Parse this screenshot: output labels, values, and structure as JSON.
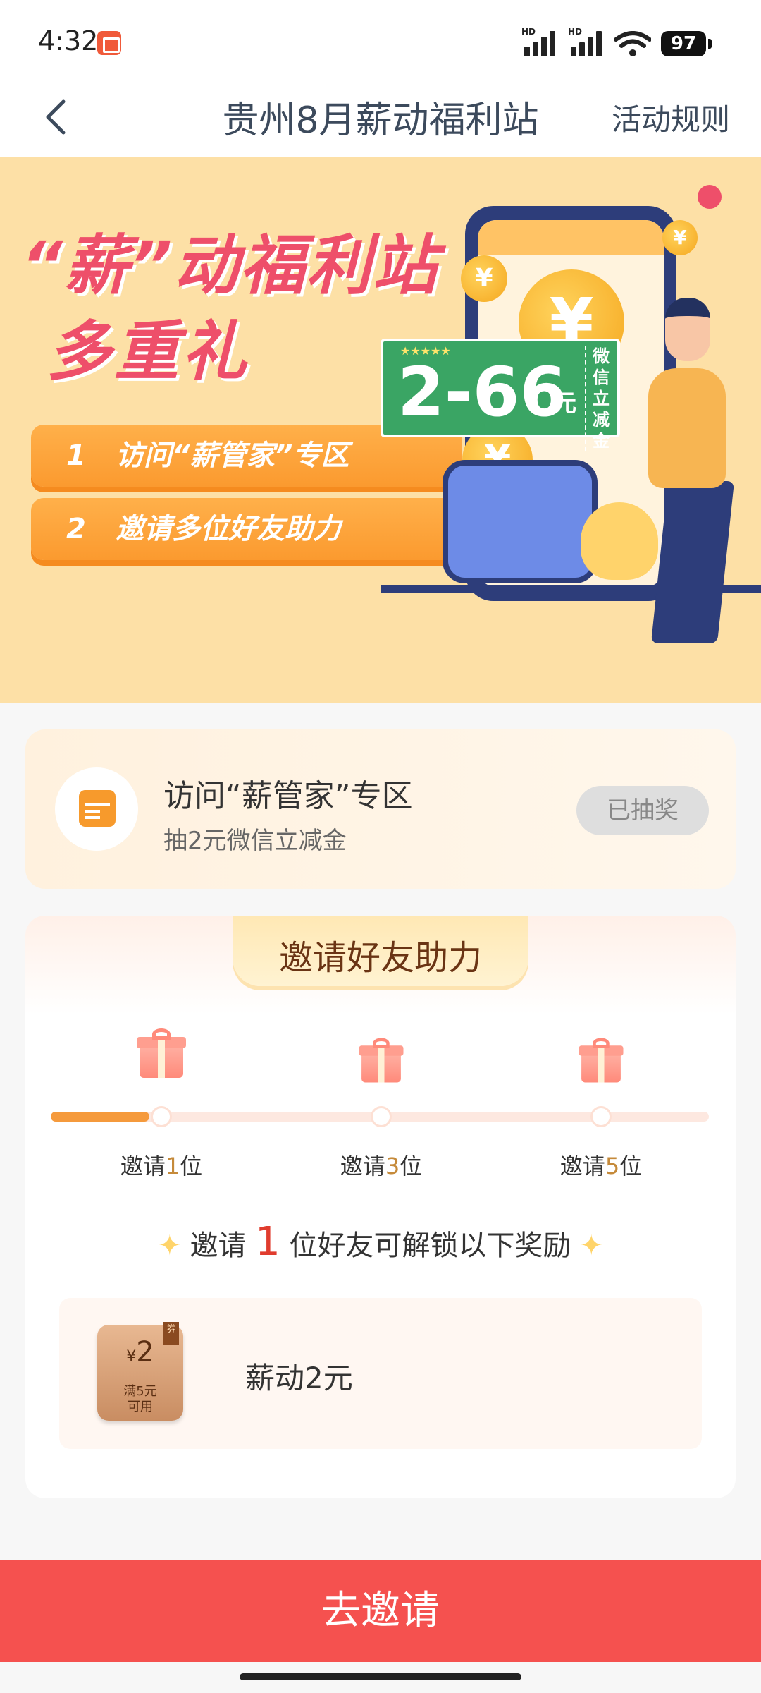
{
  "status_bar": {
    "time": "4:32",
    "signal_label": "HD",
    "battery": "97"
  },
  "nav": {
    "title": "贵州8月薪动福利站",
    "rules_label": "活动规则"
  },
  "banner": {
    "title_line1": "“薪”动福利站",
    "title_line2": "多重礼",
    "steps": [
      {
        "num": "1",
        "text": "访问“薪管家”专区"
      },
      {
        "num": "2",
        "text": "邀请多位好友助力"
      }
    ],
    "coupon_amount": "2-66",
    "coupon_unit": "元",
    "coupon_side": "微信立减金",
    "coupon_stars": "★★★★★"
  },
  "visit": {
    "title": "访问“薪管家”专区",
    "subtitle": "抽2元微信立减金",
    "button_label": "已抽奖"
  },
  "invite": {
    "title": "邀请好友助力",
    "progress_fraction": 0.15,
    "milestones": [
      {
        "prefix": "邀请",
        "count": "1",
        "suffix": "位"
      },
      {
        "prefix": "邀请",
        "count": "3",
        "suffix": "位"
      },
      {
        "prefix": "邀请",
        "count": "5",
        "suffix": "位"
      }
    ],
    "unlock_prefix": "邀请",
    "unlock_count": "1",
    "unlock_suffix": "位好友可解锁以下奖励",
    "reward": {
      "coupon_symbol": "¥",
      "coupon_value": "2",
      "coupon_tag": "券",
      "coupon_condition_1": "满5元",
      "coupon_condition_2": "可用",
      "name": "薪动2元"
    }
  },
  "cta_label": "去邀请",
  "colors": {
    "accent_red": "#f5514f",
    "progress_orange": "#f59a3c",
    "banner_bg": "#fde0a6"
  }
}
